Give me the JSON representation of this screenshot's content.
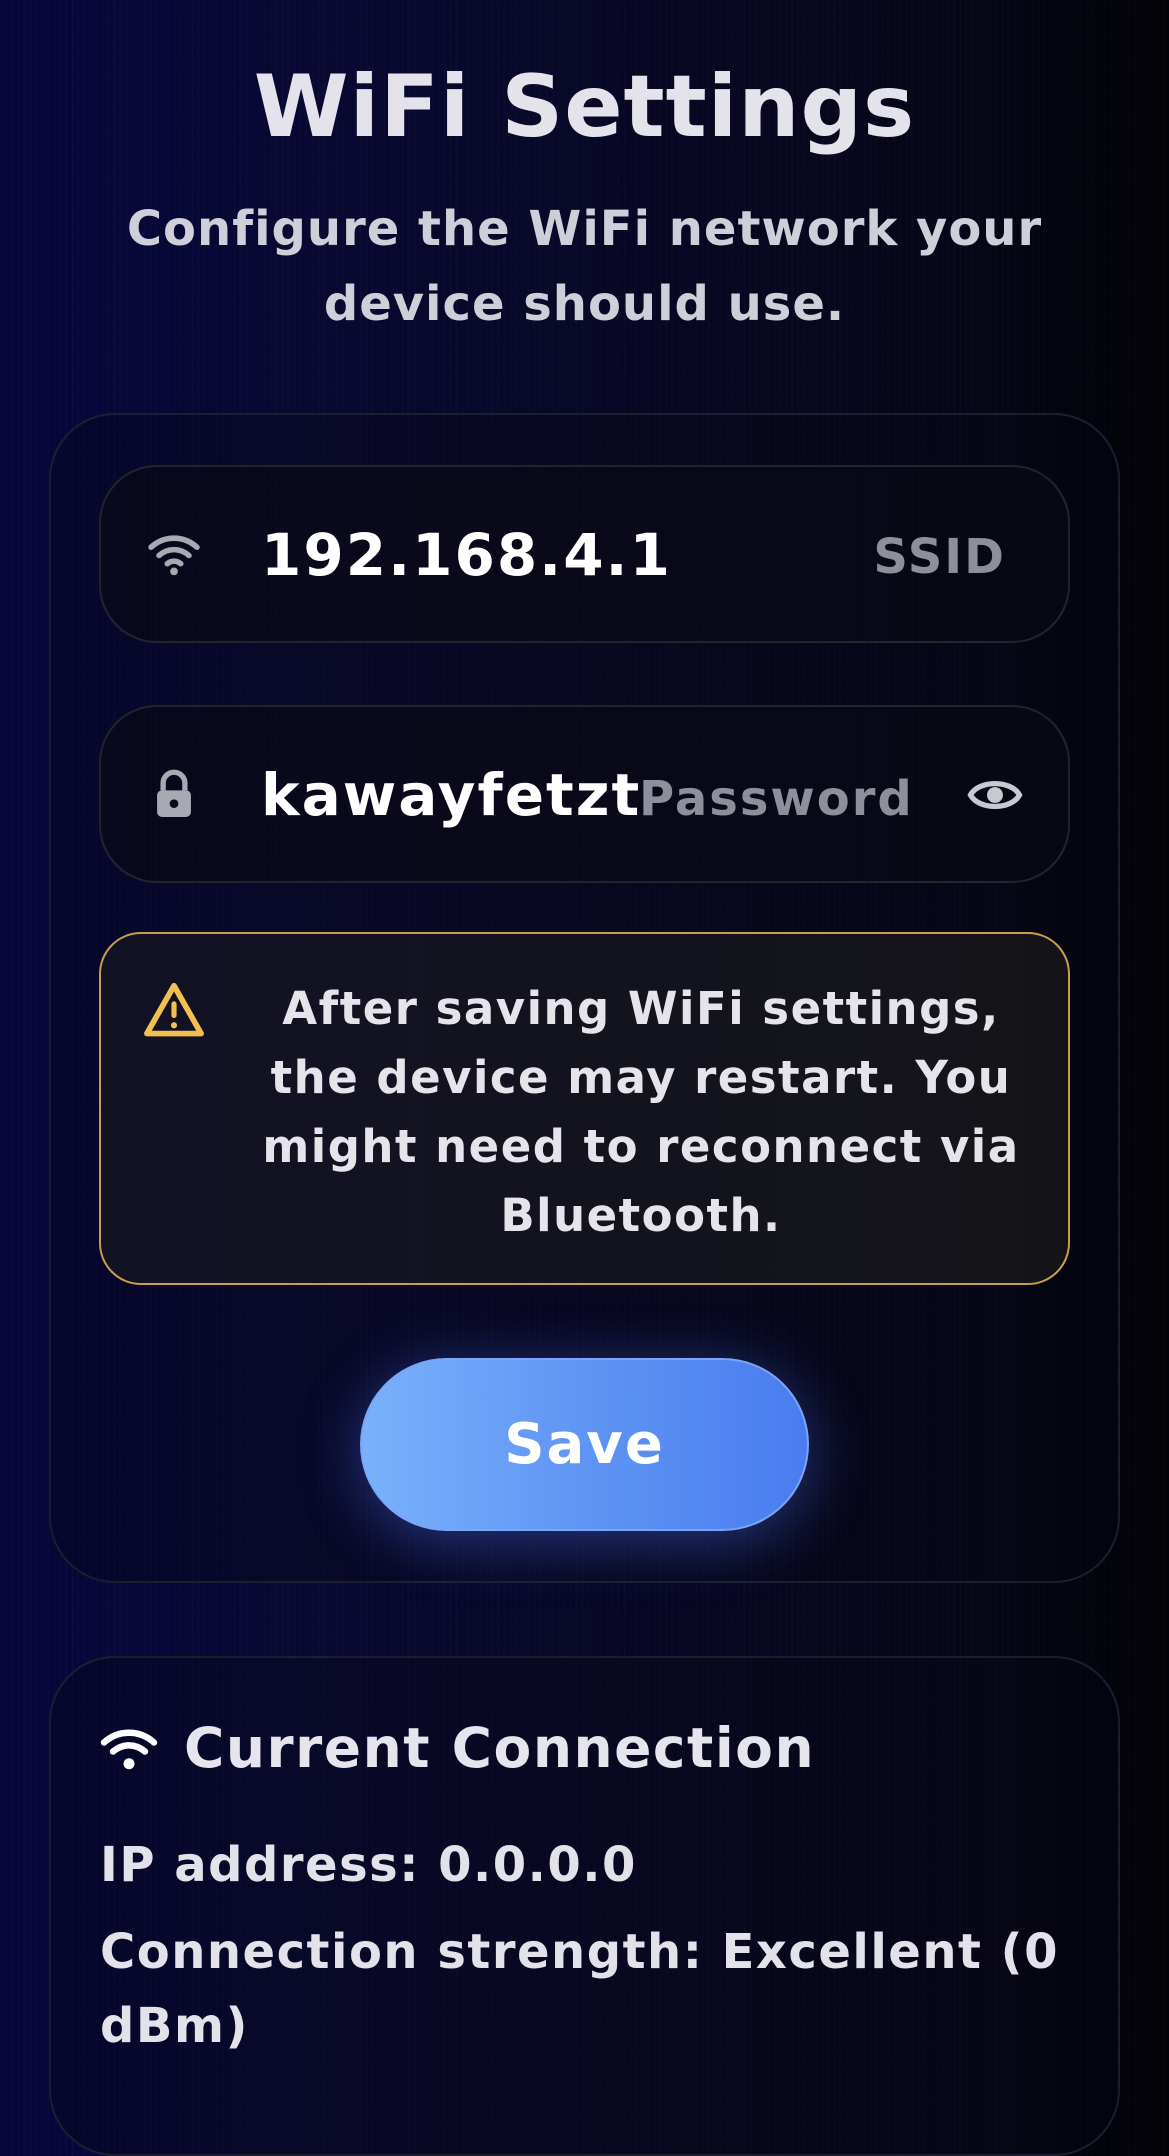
{
  "page": {
    "title": "WiFi Settings",
    "subtitle": "Configure the WiFi network your device should use."
  },
  "wifi_form": {
    "ssid": {
      "icon": "wifi-icon",
      "value": "192.168.4.1",
      "label": "SSID"
    },
    "password": {
      "icon": "lock-icon",
      "value": "kawayfetzt",
      "label": "Password",
      "toggle_icon": "eye-icon"
    },
    "warning": {
      "icon": "warning-icon",
      "text": "After saving WiFi settings, the device may restart. You might need to reconnect via Bluetooth."
    },
    "save_label": "Save"
  },
  "connection": {
    "icon": "wifi-icon",
    "title": "Current Connection",
    "ip_line": "IP address: 0.0.0.0",
    "strength_line": "Connection strength: Excellent (0 dBm)"
  },
  "colors": {
    "background": "#070720",
    "accent": "#5d92f3",
    "warning_border": "#c79e4a",
    "warning_icon": "#f1c04e",
    "text": "#e3e2ea",
    "muted": "#8f8f9b"
  }
}
